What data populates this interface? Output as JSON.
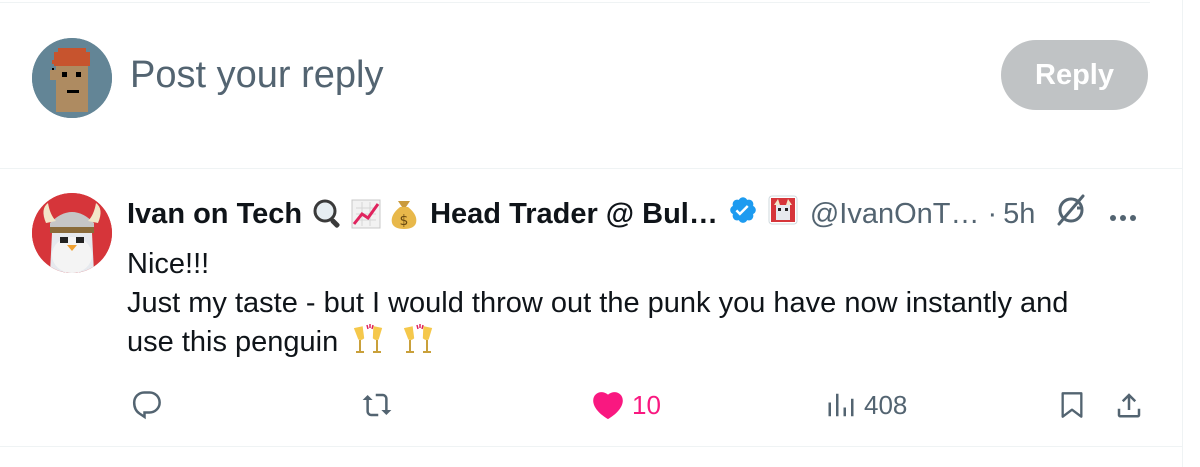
{
  "composer": {
    "placeholder": "Post your reply",
    "reply_button": "Reply"
  },
  "tweet": {
    "author_name": "Ivan on Tech",
    "author_title": "Head Trader @ Bul…",
    "handle": "@IvanOnT…",
    "separator": "·",
    "time": "5h",
    "emojis": [
      "magnifier-emoji",
      "chart-increasing-emoji",
      "money-bag-emoji"
    ],
    "text_line1": "Nice!!!",
    "text_line2": "Just my taste - but I would throw out the punk you have now instantly and",
    "text_line3": "use this penguin",
    "text_emojis": [
      "clinking-glasses-emoji",
      "clinking-glasses-emoji"
    ],
    "likes": "10",
    "views": "408"
  },
  "colors": {
    "accent": "#1d9bf0",
    "like": "#f91880",
    "secondary_text": "#536471",
    "reply_button_disabled": "#c0c3c5"
  }
}
